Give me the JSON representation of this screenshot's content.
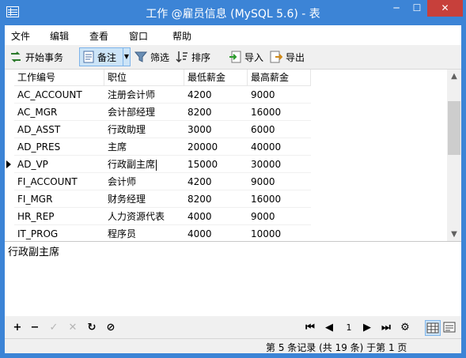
{
  "window": {
    "title": "工作 @雇员信息 (MySQL 5.6) - 表",
    "min_label": "─",
    "max_label": "☐",
    "close_label": "✕"
  },
  "menu": {
    "items": [
      {
        "label": "文件"
      },
      {
        "label": "编辑"
      },
      {
        "label": "查看"
      },
      {
        "label": "窗口"
      },
      {
        "label": "帮助"
      }
    ]
  },
  "toolbar": {
    "begin_tx": "开始事务",
    "memo": "备注",
    "filter": "筛选",
    "sort": "排序",
    "import": "导入",
    "export": "导出"
  },
  "grid": {
    "columns": [
      "工作编号",
      "职位",
      "最低薪金",
      "最高薪金"
    ],
    "rows": [
      [
        "AC_ACCOUNT",
        "注册会计师",
        "4200",
        "9000"
      ],
      [
        "AC_MGR",
        "会计部经理",
        "8200",
        "16000"
      ],
      [
        "AD_ASST",
        "行政助理",
        "3000",
        "6000"
      ],
      [
        "AD_PRES",
        "主席",
        "20000",
        "40000"
      ],
      [
        "AD_VP",
        "行政副主席",
        "15000",
        "30000"
      ],
      [
        "FI_ACCOUNT",
        "会计师",
        "4200",
        "9000"
      ],
      [
        "FI_MGR",
        "财务经理",
        "8200",
        "16000"
      ],
      [
        "HR_REP",
        "人力资源代表",
        "4000",
        "9000"
      ],
      [
        "IT_PROG",
        "程序员",
        "4000",
        "10000"
      ]
    ],
    "current_row": 4
  },
  "memo": {
    "text": "行政副主席"
  },
  "navigator": {
    "page": "1"
  },
  "status": {
    "text": "第 5 条记录 (共 19 条) 于第 1 页"
  },
  "colors": {
    "titlebar": "#3c84d6",
    "close": "#c7403b",
    "selected": "#cce4f7"
  }
}
